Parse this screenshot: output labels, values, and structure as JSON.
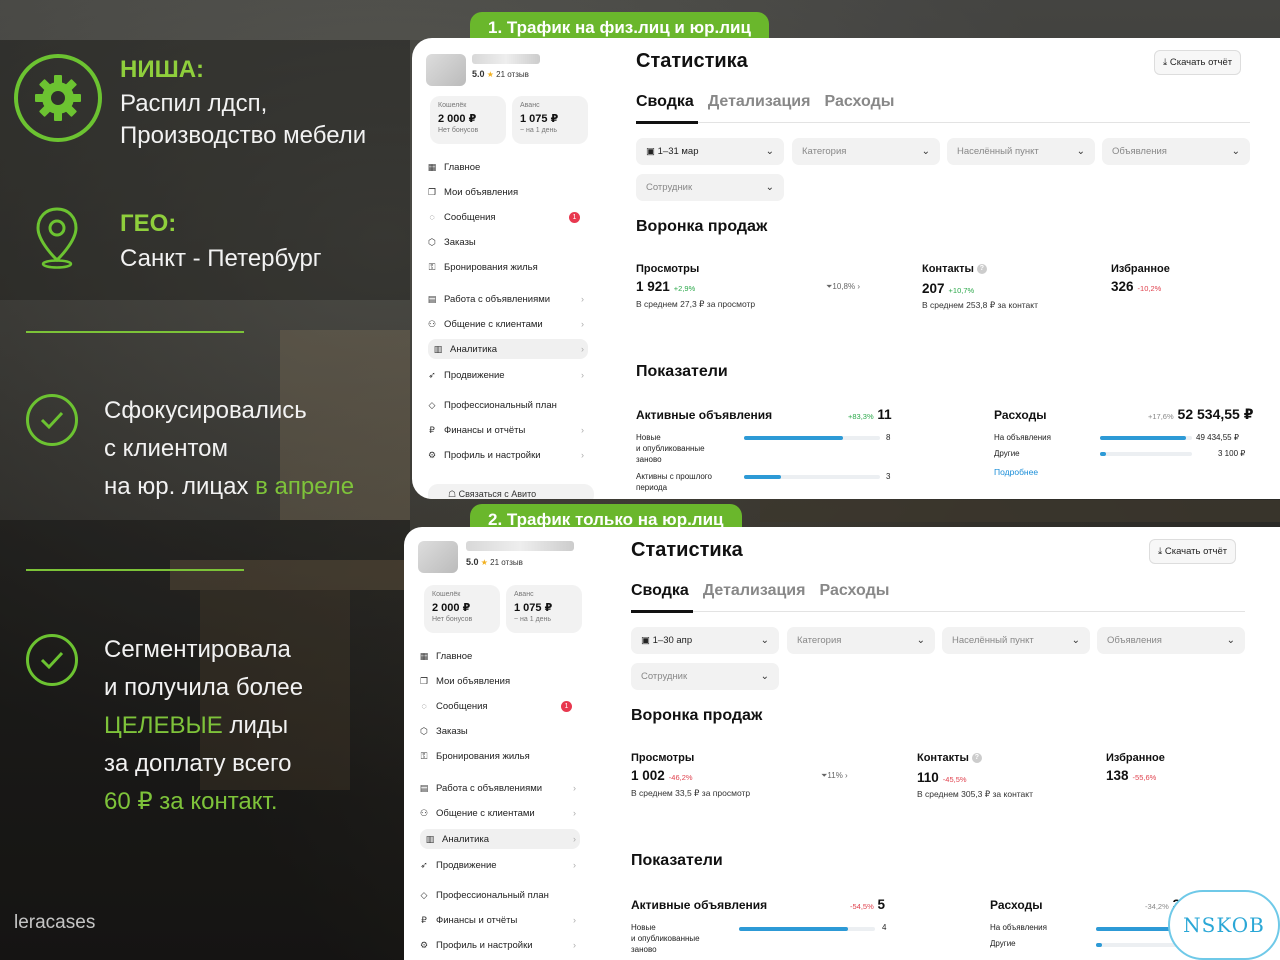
{
  "left": {
    "niche_header": "НИША:",
    "niche_line1": "Распил лдсп,",
    "niche_line2": "Производство мебели",
    "geo_header": "ГЕО:",
    "geo_text": "Санкт - Петербург",
    "point1_line1": "Сфокусировались",
    "point1_line2": "с клиентом",
    "point1_line3a": "на юр. лицах",
    "point1_line3b": "в апреле",
    "point2_line1": "Сегментировала",
    "point2_line2": "и получила более",
    "point2_line3a": "ЦЕЛЕВЫЕ",
    "point2_line3b": "лиды",
    "point2_line4": "за доплату всего",
    "point2_line5": "60 ₽ за контакт.",
    "watermark": "leracases",
    "accent_color": "#7ec33a"
  },
  "labels": {
    "tag1": "1. Трафик на физ.лиц и юр.лиц",
    "tag2": "2. Трафик только на юр.лиц"
  },
  "badge": "NSKOB",
  "sidebar": {
    "rating": "5.0",
    "reviews": "21 отзыв",
    "wallet_label": "Кошелёк",
    "wallet_amount": "2 000 ₽",
    "wallet_note": "Нет бонусов",
    "advance_label": "Аванс",
    "advance_amount": "1 075 ₽",
    "advance_note": "~ на 1 день",
    "items": [
      {
        "label": "Главное",
        "icon": "grid-icon"
      },
      {
        "label": "Мои объявления",
        "icon": "ads-icon"
      },
      {
        "label": "Сообщения",
        "icon": "chat-icon",
        "badge": "1"
      },
      {
        "label": "Заказы",
        "icon": "box-icon"
      },
      {
        "label": "Бронирования жилья",
        "icon": "key-icon"
      },
      {
        "label": "Работа с объявлениями",
        "icon": "edit-icon"
      },
      {
        "label": "Общение с клиентами",
        "icon": "people-icon"
      },
      {
        "label": "Аналитика",
        "icon": "chart-icon"
      },
      {
        "label": "Продвижение",
        "icon": "rocket-icon"
      },
      {
        "label": "Профессиональный план",
        "icon": "diamond-icon"
      },
      {
        "label": "Финансы и отчёты",
        "icon": "ruble-icon"
      },
      {
        "label": "Профиль и настройки",
        "icon": "settings-icon"
      }
    ],
    "contact": "Связаться с Авито"
  },
  "page": {
    "title": "Статистика",
    "download": "Скачать отчёт",
    "tabs": [
      "Сводка",
      "Детализация",
      "Расходы"
    ],
    "filter_category": "Категория",
    "filter_city": "Населённый пункт",
    "filter_ads": "Объявления",
    "filter_employee": "Сотрудник",
    "funnel_title": "Воронка продаж",
    "views_label": "Просмотры",
    "contacts_label": "Контакты",
    "fav_label": "Избранное",
    "indicators_title": "Показатели",
    "active_label": "Активные объявления",
    "new_label_1": "Новые",
    "new_label_2": "и опубликованные",
    "new_label_3": "заново",
    "prev_label_1": "Активны с прошлого",
    "prev_label_2": "периода",
    "expenses_label": "Расходы",
    "on_ads": "На объявления",
    "other": "Другие",
    "more": "Подробнее"
  },
  "panel1": {
    "period": "1–31 мар",
    "views": "1 921",
    "views_pct": "+2,9%",
    "views_avg": "В среднем 27,3 ₽ за просмотр",
    "conversion": "10,8%",
    "contacts": "207",
    "contacts_pct": "+10,7%",
    "contacts_avg": "В среднем 253,8 ₽ за контакт",
    "fav": "326",
    "fav_pct": "-10,2%",
    "active_pct": "+83,3%",
    "active": "11",
    "new_count": "8",
    "new_fill": 0.73,
    "prev_count": "3",
    "prev_fill": 0.27,
    "exp_pct": "+17,6%",
    "expenses": "52 534,55 ₽",
    "exp_ads": "49 434,55 ₽",
    "exp_ads_fill": 0.94,
    "exp_other": "3 100 ₽",
    "exp_other_fill": 0.06
  },
  "panel2": {
    "period": "1–30 апр",
    "views": "1 002",
    "views_pct": "-46,2%",
    "views_avg": "В среднем 33,5 ₽ за просмотр",
    "conversion": "11%",
    "contacts": "110",
    "contacts_pct": "-45,5%",
    "contacts_avg": "В среднем 305,3 ₽ за контакт",
    "fav": "138",
    "fav_pct": "-55,6%",
    "active_pct": "-54,5%",
    "active": "5",
    "new_count": "4",
    "new_fill": 0.8,
    "exp_pct": "-34,2%",
    "expenses": "33"
  }
}
